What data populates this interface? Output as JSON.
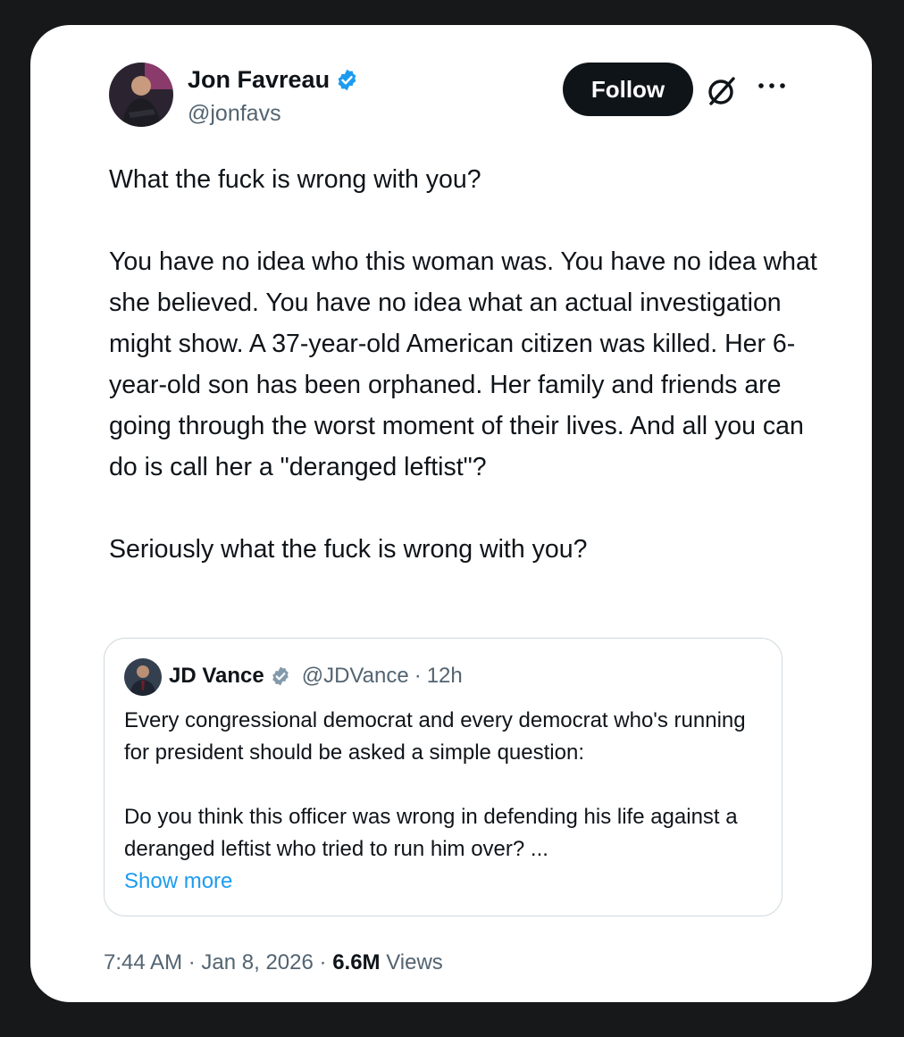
{
  "tweet": {
    "author_name": "Jon Favreau",
    "author_handle": "@jonfavs",
    "follow_label": "Follow",
    "paragraphs": [
      "What the fuck is wrong with you?",
      "You have no idea who this woman was. You have no idea what she believed. You have no idea what an actual investigation might show. A 37-year-old American citizen was killed. Her 6-year-old son has been orphaned. Her family and friends are going through the worst moment of their lives. And all you can do is call her a \"deranged leftist\"?",
      "Seriously what the fuck is wrong with you?"
    ],
    "time": "7:44 AM",
    "date": "Jan 8, 2026",
    "views_count": "6.6M",
    "views_label": "Views"
  },
  "quote": {
    "author_name": "JD Vance",
    "author_handle": "@JDVance",
    "time_ago": "12h",
    "paragraphs": [
      "Every congressional democrat and every democrat who's running for president should be asked a simple question:",
      "Do you think this officer was wrong in defending his life against a deranged leftist who tried to run him over? ..."
    ],
    "show_more_label": "Show more"
  },
  "icons": {
    "verified": "verified-badge-icon",
    "grok": "grok-icon",
    "more": "more-options-icon"
  },
  "colors": {
    "verified_blue": "#1d9bf0",
    "quote_verified_gray": "#829aab",
    "link_blue": "#1d9bf0",
    "text_primary": "#0f1419",
    "text_secondary": "#536471",
    "follow_bg": "#0f1419",
    "page_bg": "#17181a"
  }
}
